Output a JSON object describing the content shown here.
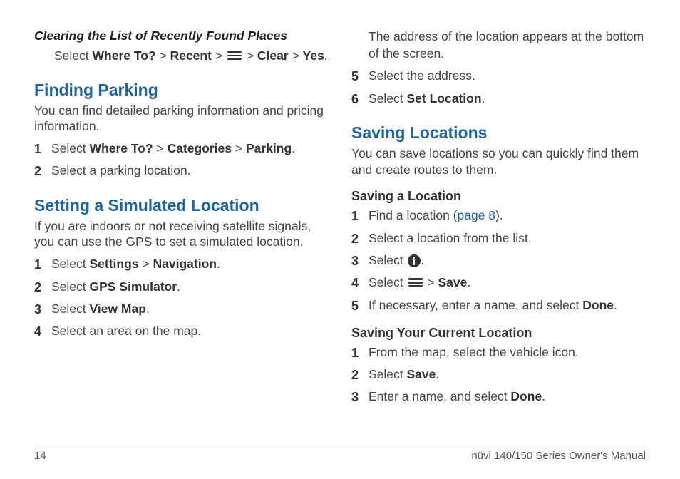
{
  "leftCol": {
    "clearing": {
      "title": "Clearing the List of Recently Found Places",
      "step_pre": "Select ",
      "b1": "Where To?",
      "gt1": " > ",
      "b2": "Recent",
      "gt2": " > ",
      "gt3": " > ",
      "b3": "Clear",
      "gt4": " > ",
      "b4": "Yes",
      "dot": "."
    },
    "parking": {
      "title": "Finding Parking",
      "intro": "You can find detailed parking information and pricing information.",
      "steps": [
        {
          "num": "1",
          "pre": "Select ",
          "b1": "Where To?",
          "m1": " > ",
          "b2": "Categories",
          "m2": " > ",
          "b3": "Parking",
          "post": "."
        },
        {
          "num": "2",
          "text": "Select a parking location."
        }
      ]
    },
    "simloc": {
      "title": "Setting a Simulated Location",
      "intro": "If you are indoors or not receiving satellite signals, you can use the GPS to set a simulated location.",
      "steps": [
        {
          "num": "1",
          "pre": "Select ",
          "b1": "Settings",
          "m1": " > ",
          "b2": "Navigation",
          "post": "."
        },
        {
          "num": "2",
          "pre": "Select ",
          "b1": "GPS Simulator",
          "post": "."
        },
        {
          "num": "3",
          "pre": "Select ",
          "b1": "View Map",
          "post": "."
        },
        {
          "num": "4",
          "text": "Select an area on the map."
        }
      ]
    }
  },
  "rightCol": {
    "cont": {
      "note": "The address of the location appears at the bottom of the screen.",
      "steps": [
        {
          "num": "5",
          "text": "Select the address."
        },
        {
          "num": "6",
          "pre": "Select ",
          "b1": "Set Location",
          "post": "."
        }
      ]
    },
    "saving": {
      "title": "Saving Locations",
      "intro": "You can save locations so you can quickly find them and create routes to them.",
      "sub1": {
        "title": "Saving a Location",
        "steps": [
          {
            "num": "1",
            "pre": "Find a location (",
            "link": "page 8",
            "post": ")."
          },
          {
            "num": "2",
            "text": "Select a location from the list."
          },
          {
            "num": "3",
            "pre": "Select ",
            "post": "."
          },
          {
            "num": "4",
            "pre": "Select ",
            "m1": " > ",
            "b1": "Save",
            "post": "."
          },
          {
            "num": "5",
            "pre": "If necessary, enter a name, and select ",
            "b1": "Done",
            "post": "."
          }
        ]
      },
      "sub2": {
        "title": "Saving Your Current Location",
        "steps": [
          {
            "num": "1",
            "text": "From the map, select the vehicle icon."
          },
          {
            "num": "2",
            "pre": "Select ",
            "b1": "Save",
            "post": "."
          },
          {
            "num": "3",
            "pre": "Enter a name, and select ",
            "b1": "Done",
            "post": "."
          }
        ]
      }
    }
  },
  "footer": {
    "page": "14",
    "title": "nüvi 140/150 Series Owner's Manual"
  }
}
